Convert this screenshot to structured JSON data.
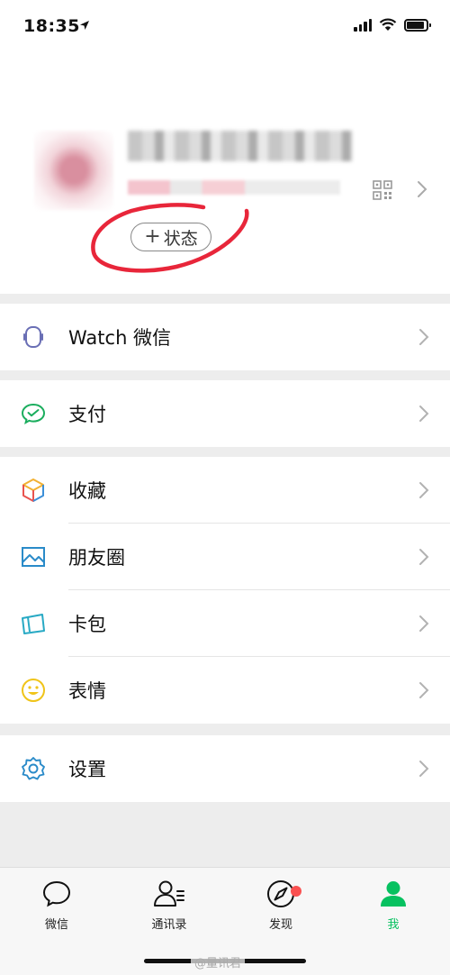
{
  "status_bar": {
    "time": "18:35"
  },
  "profile": {
    "status_button_label": "状态",
    "status_button_plus": "+"
  },
  "menu": {
    "watch": "Watch 微信",
    "pay": "支付",
    "favorites": "收藏",
    "moments": "朋友圈",
    "cards": "卡包",
    "stickers": "表情",
    "settings": "设置"
  },
  "tabbar": {
    "tabs": [
      {
        "label": "微信",
        "icon": "chat-bubble-icon"
      },
      {
        "label": "通讯录",
        "icon": "contacts-icon"
      },
      {
        "label": "发现",
        "icon": "compass-icon",
        "badge": true
      },
      {
        "label": "我",
        "icon": "person-icon",
        "active": true
      }
    ]
  },
  "watermark": "@量讯君",
  "colors": {
    "accent": "#07c160",
    "badge": "#fa5151",
    "annotation": "#e8263a"
  }
}
